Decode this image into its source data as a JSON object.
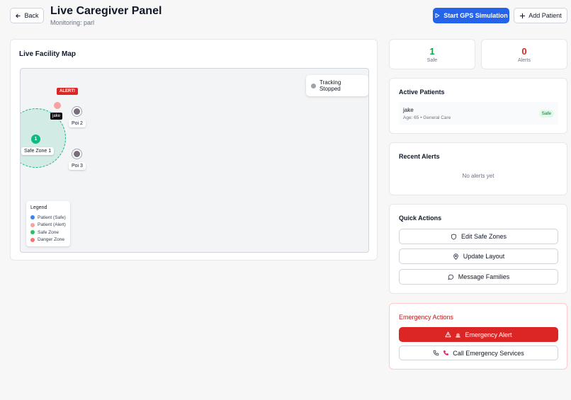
{
  "header": {
    "back_label": "Back",
    "title": "Live Caregiver Panel",
    "subtitle": "Monitoring: parl",
    "gps_label": "Start GPS Simulation",
    "add_label": "Add Patient"
  },
  "map": {
    "title": "Live Facility Map",
    "tracking_status": "Tracking Stopped",
    "alert_tag": "ALERT!",
    "patient_tag": "jake",
    "zone_label": "Safe Zone 1",
    "zone_number": "1",
    "pois": [
      {
        "label": "Poi 2"
      },
      {
        "label": "Poi 3"
      }
    ],
    "legend": {
      "title": "Legend",
      "items": [
        {
          "label": "Patient (Safe)",
          "color": "#3b82f6"
        },
        {
          "label": "Patient (Alert)",
          "color": "#f3a3a3"
        },
        {
          "label": "Safe Zone",
          "color": "#22c55e"
        },
        {
          "label": "Danger Zone",
          "color": "#f87171"
        }
      ]
    }
  },
  "stats": {
    "safe": {
      "value": "1",
      "label": "Safe",
      "color": "#16a34a"
    },
    "alerts": {
      "value": "0",
      "label": "Alerts",
      "color": "#dc2626"
    }
  },
  "active_patients": {
    "title": "Active Patients",
    "patients": [
      {
        "name": "jake",
        "meta": "Age: 65 • General Care",
        "status": "Safe"
      }
    ]
  },
  "recent_alerts": {
    "title": "Recent Alerts",
    "empty": "No alerts yet"
  },
  "quick_actions": {
    "title": "Quick Actions",
    "edit_zones": "Edit Safe Zones",
    "update_layout": "Update Layout",
    "message_families": "Message Families"
  },
  "emergency": {
    "title": "Emergency Actions",
    "alert_label": "Emergency Alert",
    "call_label": "Call Emergency Services"
  }
}
